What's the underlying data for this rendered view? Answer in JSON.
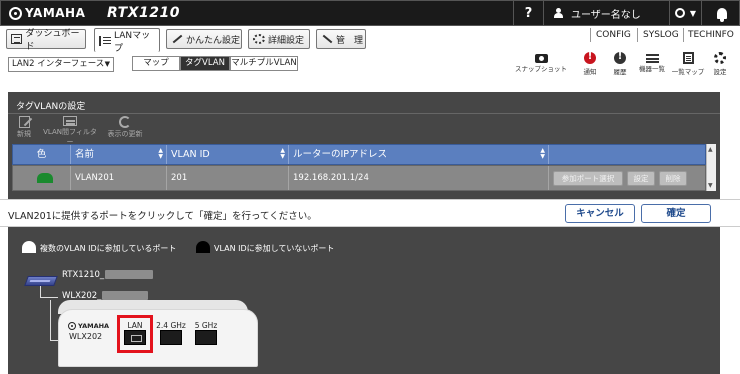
{
  "header": {
    "brand": "YAMAHA",
    "model": "RTX1210",
    "help_label": "?",
    "user_name": "ユーザー名なし"
  },
  "nav": {
    "tabs": [
      {
        "label": "ダッシュボード"
      },
      {
        "label": "LANマップ"
      },
      {
        "label": "かんたん設定"
      },
      {
        "label": "詳細設定"
      },
      {
        "label": "管　理"
      }
    ],
    "links": [
      "CONFIG",
      "SYSLOG",
      "TECHINFO"
    ]
  },
  "toolbar": {
    "interface_select": "LAN2 インターフェース",
    "view_modes": [
      "マップ",
      "タグVLAN",
      "マルチプルVLAN"
    ],
    "active_view": "タグVLAN",
    "tools": [
      {
        "label": "スナップショット",
        "icon": "camera-icon"
      },
      {
        "label": "通知",
        "icon": "alert-icon",
        "color": "#c8141e"
      },
      {
        "label": "履歴",
        "icon": "history-icon"
      },
      {
        "label": "機器一覧",
        "icon": "list-icon"
      },
      {
        "label": "一覧マップ",
        "icon": "page-icon"
      },
      {
        "label": "設定",
        "icon": "gear-icon"
      }
    ]
  },
  "panel": {
    "title": "タグVLANの設定",
    "actions": [
      {
        "label": "新規",
        "icon": "edit-icon"
      },
      {
        "label": "VLAN間フィルター",
        "icon": "filter-icon"
      },
      {
        "label": "表示の更新",
        "icon": "refresh-icon"
      }
    ],
    "table": {
      "columns": [
        "色",
        "名前",
        "VLAN ID",
        "ルーターのIPアドレス"
      ],
      "rows": [
        {
          "color": "#1a8a2e",
          "name": "VLAN201",
          "vlan_id": "201",
          "ip": "192.168.201.1/24"
        }
      ],
      "row_buttons": [
        "参加ポート選択",
        "設定",
        "削除"
      ]
    }
  },
  "message": {
    "text": "VLAN201に提供するポートをクリックして「確定」を行ってください。",
    "cancel": "キャンセル",
    "confirm": "確定"
  },
  "legend": {
    "multi": "複数のVLAN IDに参加しているポート",
    "none": "VLAN IDに参加していないポート"
  },
  "topology": {
    "router_name": "RTX1210_",
    "ap_name": "WLX202_",
    "ap": {
      "brand": "YAMAHA",
      "model": "WLX202",
      "ports": [
        "LAN",
        "2.4 GHz",
        "5 GHz"
      ]
    }
  },
  "colors": {
    "accent_blue": "#5b7fbf",
    "panel_dark": "#464646",
    "highlight_red": "#e3121c"
  }
}
